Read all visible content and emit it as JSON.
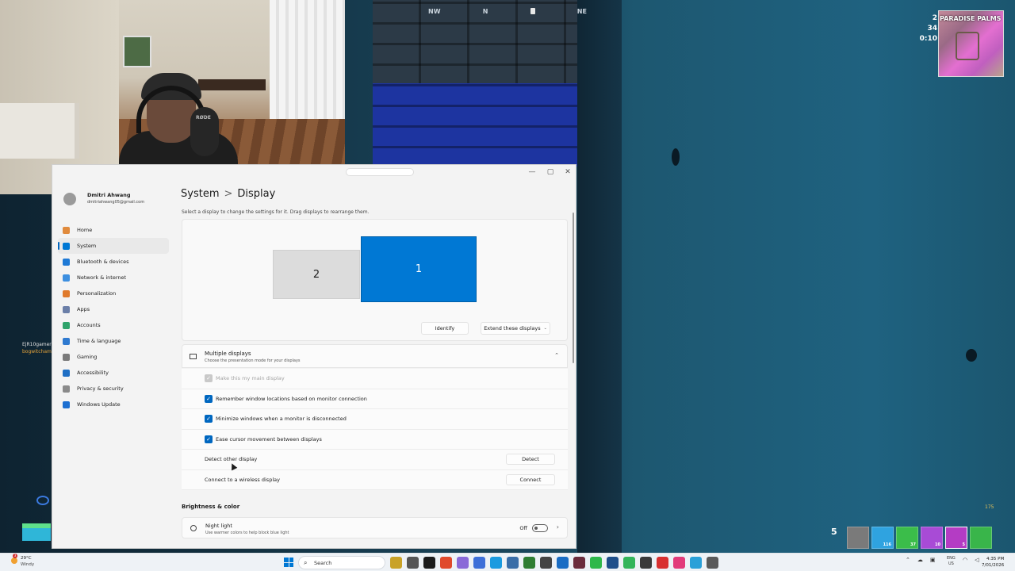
{
  "game": {
    "compass": [
      "NW",
      "N",
      "NE"
    ],
    "stats": [
      "2",
      "34",
      "0:10"
    ],
    "location": "PARADISE PALMS",
    "killfeed": [
      "EjR10gamer ol",
      "bogwitcham"
    ],
    "materials": "5",
    "ammo": "175",
    "hotbar_quantities": [
      "",
      "116",
      "37",
      "10",
      "5",
      ""
    ]
  },
  "webcam": {
    "mic_label": "RØDE"
  },
  "settings": {
    "profile": {
      "name": "Dmitri Ahwang",
      "email": "dmitriahwang05@gmail.com"
    },
    "nav": [
      {
        "label": "Home",
        "color": "#e08a3c"
      },
      {
        "label": "System",
        "color": "#0078d4"
      },
      {
        "label": "Bluetooth & devices",
        "color": "#1f7ad6"
      },
      {
        "label": "Network & internet",
        "color": "#3d8fe0"
      },
      {
        "label": "Personalization",
        "color": "#e07a2c"
      },
      {
        "label": "Apps",
        "color": "#6b7fa8"
      },
      {
        "label": "Accounts",
        "color": "#2fa36b"
      },
      {
        "label": "Time & language",
        "color": "#2f7ad0"
      },
      {
        "label": "Gaming",
        "color": "#7a7a7a"
      },
      {
        "label": "Accessibility",
        "color": "#1f6fc4"
      },
      {
        "label": "Privacy & security",
        "color": "#8a8a8a"
      },
      {
        "label": "Windows Update",
        "color": "#1c6fd1"
      }
    ],
    "breadcrumb": {
      "parent": "System",
      "sep": ">",
      "current": "Display"
    },
    "hint": "Select a display to change the settings for it. Drag displays to rearrange them.",
    "monitors": {
      "secondary": "2",
      "primary": "1"
    },
    "identify_label": "Identify",
    "extend_label": "Extend these displays",
    "multiple": {
      "title": "Multiple displays",
      "subtitle": "Choose the presentation mode for your displays"
    },
    "options": [
      {
        "label": "Make this my main display",
        "checked": true,
        "disabled": true
      },
      {
        "label": "Remember window locations based on monitor connection",
        "checked": true,
        "disabled": false
      },
      {
        "label": "Minimize windows when a monitor is disconnected",
        "checked": true,
        "disabled": false
      },
      {
        "label": "Ease cursor movement between displays",
        "checked": true,
        "disabled": false
      }
    ],
    "detect": {
      "label": "Detect other display",
      "button": "Detect"
    },
    "wireless": {
      "label": "Connect to a wireless display",
      "button": "Connect"
    },
    "brightness_section": "Brightness & color",
    "night_light": {
      "title": "Night light",
      "subtitle": "Use warmer colors to help block blue light",
      "state": "Off"
    }
  },
  "taskbar": {
    "weather_temp": "29°C",
    "weather_desc": "Windy",
    "notification_count": "3",
    "search_placeholder": "Search",
    "app_colors": [
      "#c9a227",
      "#555555",
      "#1b1b1b",
      "#e04a2c",
      "#8a6ad8",
      "#3d6fd8",
      "#1a9be0",
      "#3a6ea8",
      "#2e7d32",
      "#444444",
      "#1a6dc4",
      "#6b2c3c",
      "#2fb84a",
      "#1f4f8a",
      "#33b55a",
      "#3a3a3a",
      "#d83030",
      "#e23b7a",
      "#2aa0d8",
      "#5a5a5a"
    ],
    "language": "ENG",
    "region": "US",
    "time": "4:35 PM",
    "date": "7/01/2026"
  }
}
